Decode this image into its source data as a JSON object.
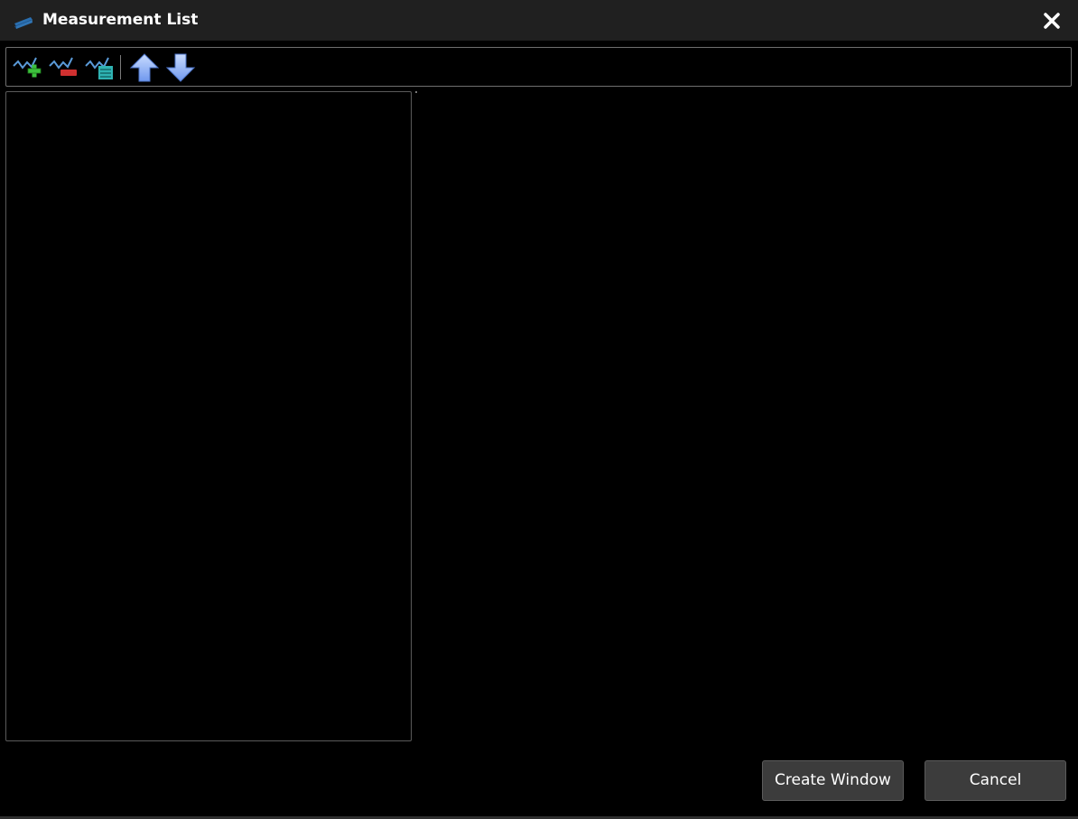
{
  "window": {
    "title": "Measurement List",
    "app_icon": "layers-app-icon",
    "close_icon": "close-icon"
  },
  "toolbar": {
    "buttons": [
      {
        "icon": "add-measurement-icon",
        "accent": "#3cc03c"
      },
      {
        "icon": "remove-measurement-icon",
        "accent": "#d03030"
      },
      {
        "icon": "edit-measurement-icon",
        "accent": "#2fb3b3"
      },
      {
        "icon": "move-up-icon",
        "accent": "#8fb4ff"
      },
      {
        "icon": "move-down-icon",
        "accent": "#8fb4ff"
      }
    ]
  },
  "measurement_list": {
    "items": []
  },
  "footer": {
    "create_label": "Create Window",
    "cancel_label": "Cancel"
  },
  "colors": {
    "titlebar_bg": "#202020",
    "background": "#000000",
    "button_bg": "#3c3c3c",
    "border": "#6f6f6f"
  }
}
